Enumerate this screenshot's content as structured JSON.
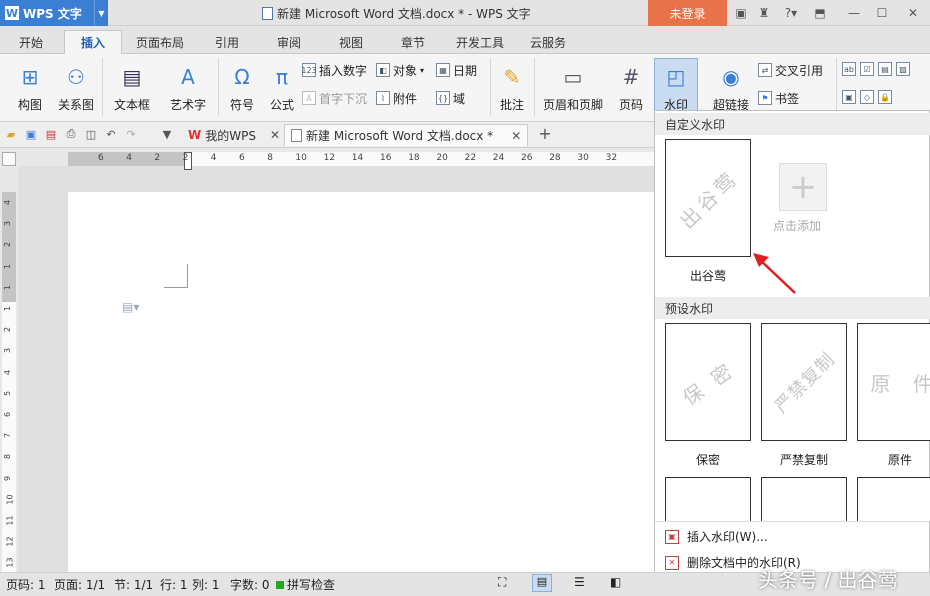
{
  "app": {
    "name": "WPS 文字",
    "logo": "W"
  },
  "window": {
    "title": "新建 Microsoft Word 文档.docx * - WPS 文字",
    "login_label": "未登录"
  },
  "menu_tabs": [
    "开始",
    "插入",
    "页面布局",
    "引用",
    "审阅",
    "视图",
    "章节",
    "开发工具",
    "云服务"
  ],
  "active_tab": "插入",
  "ribbon": {
    "big_buttons": [
      "构图",
      "关系图",
      "文本框",
      "艺术字",
      "符号",
      "公式",
      "批注",
      "页眉和页脚",
      "页码",
      "水印",
      "超链接"
    ],
    "small_buttons": [
      "插入数字",
      "对象",
      "日期",
      "首字下沉",
      "附件",
      "域",
      "交叉引用",
      "书签"
    ]
  },
  "doc_tabs": [
    {
      "label": "我的WPS"
    },
    {
      "label": "新建 Microsoft Word 文档.docx *"
    }
  ],
  "ruler": {
    "h_numbers": [
      "6",
      "4",
      "2",
      "2",
      "4",
      "6",
      "8",
      "10",
      "12",
      "14",
      "16",
      "18",
      "20",
      "22",
      "24",
      "26",
      "28",
      "30",
      "32"
    ],
    "v_numbers": [
      "4",
      "3",
      "2",
      "1",
      "1",
      "1",
      "2",
      "3",
      "4",
      "5",
      "6",
      "7",
      "8",
      "9",
      "10",
      "11",
      "12",
      "13"
    ]
  },
  "watermark_panel": {
    "custom_header": "自定义水印",
    "custom_items": [
      {
        "text": "出谷莺",
        "label": "出谷莺"
      }
    ],
    "add_label": "点击添加",
    "preset_header": "预设水印",
    "preset_items": [
      {
        "text": "保 密",
        "label": "保密"
      },
      {
        "text": "严禁复制",
        "label": "严禁复制"
      },
      {
        "text": "原 件",
        "label": "原件"
      }
    ],
    "menu": [
      "插入水印(W)...",
      "删除文档中的水印(R)"
    ]
  },
  "status": {
    "page": "页码: 1",
    "pages": "页面: 1/1",
    "section": "节: 1/1",
    "row": "行: 1",
    "col": "列: 1",
    "words": "字数: 0",
    "spell": "拼写检查"
  },
  "credit": "头条号 / 出谷莺",
  "colors": {
    "accent": "#3b7fd4",
    "login": "#e8734a",
    "arrow": "#e02020"
  }
}
